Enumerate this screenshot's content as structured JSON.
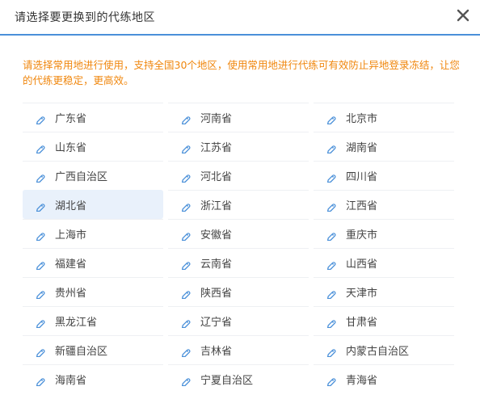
{
  "dialog": {
    "title": "请选择要更换到的代练地区",
    "close_icon": "close-icon",
    "notice": "请选择常用地进行使用，支持全国30个地区，使用常用地进行代练可有效防止异地登录冻结，让您的代练更稳定，更高效。"
  },
  "colors": {
    "accent": "#4a90d9",
    "notice": "#f0870e",
    "selected_bg": "#e9f1fb",
    "icon": "#4a90d9"
  },
  "regions": [
    {
      "label": "广东省",
      "icon": "location-pin-icon",
      "selected": false
    },
    {
      "label": "河南省",
      "icon": "location-pin-icon",
      "selected": false
    },
    {
      "label": "北京市",
      "icon": "location-pin-icon",
      "selected": false
    },
    {
      "label": "山东省",
      "icon": "location-pin-icon",
      "selected": false
    },
    {
      "label": "江苏省",
      "icon": "location-pin-icon",
      "selected": false
    },
    {
      "label": "湖南省",
      "icon": "location-pin-icon",
      "selected": false
    },
    {
      "label": "广西自治区",
      "icon": "location-pin-icon",
      "selected": false
    },
    {
      "label": "河北省",
      "icon": "location-pin-icon",
      "selected": false
    },
    {
      "label": "四川省",
      "icon": "location-pin-icon",
      "selected": false
    },
    {
      "label": "湖北省",
      "icon": "location-pin-icon",
      "selected": true
    },
    {
      "label": "浙江省",
      "icon": "location-pin-icon",
      "selected": false
    },
    {
      "label": "江西省",
      "icon": "location-pin-icon",
      "selected": false
    },
    {
      "label": "上海市",
      "icon": "location-pin-icon",
      "selected": false
    },
    {
      "label": "安徽省",
      "icon": "location-pin-icon",
      "selected": false
    },
    {
      "label": "重庆市",
      "icon": "location-pin-icon",
      "selected": false
    },
    {
      "label": "福建省",
      "icon": "location-pin-icon",
      "selected": false
    },
    {
      "label": "云南省",
      "icon": "location-pin-icon",
      "selected": false
    },
    {
      "label": "山西省",
      "icon": "location-pin-icon",
      "selected": false
    },
    {
      "label": "贵州省",
      "icon": "location-pin-icon",
      "selected": false
    },
    {
      "label": "陕西省",
      "icon": "location-pin-icon",
      "selected": false
    },
    {
      "label": "天津市",
      "icon": "location-pin-icon",
      "selected": false
    },
    {
      "label": "黑龙江省",
      "icon": "location-pin-icon",
      "selected": false
    },
    {
      "label": "辽宁省",
      "icon": "location-pin-icon",
      "selected": false
    },
    {
      "label": "甘肃省",
      "icon": "location-pin-icon",
      "selected": false
    },
    {
      "label": "新疆自治区",
      "icon": "location-pin-icon",
      "selected": false
    },
    {
      "label": "吉林省",
      "icon": "location-pin-icon",
      "selected": false
    },
    {
      "label": "内蒙古自治区",
      "icon": "location-pin-icon",
      "selected": false
    },
    {
      "label": "海南省",
      "icon": "location-pin-icon",
      "selected": false
    },
    {
      "label": "宁夏自治区",
      "icon": "location-pin-icon",
      "selected": false
    },
    {
      "label": "青海省",
      "icon": "location-pin-icon",
      "selected": false
    }
  ]
}
